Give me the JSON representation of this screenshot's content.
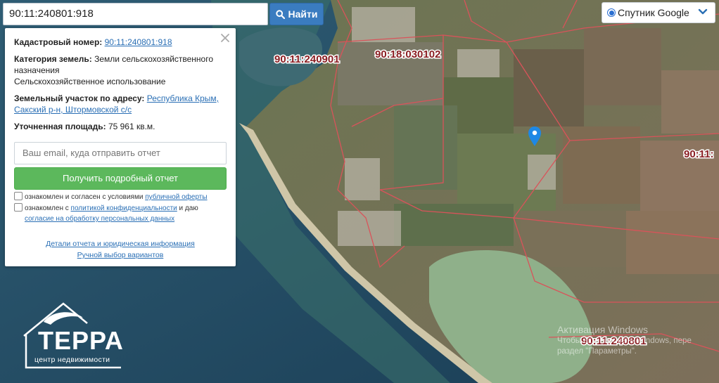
{
  "search": {
    "value": "90:11:240801:918",
    "button_label": "Найти"
  },
  "layer": {
    "label": "Спутник Google"
  },
  "panel": {
    "cadastral_label": "Кадастровый номер:",
    "cadastral_value": "90:11:240801:918",
    "category_label": "Категория земель:",
    "category_value_1": "Земли сельскохозяйственного назначения",
    "category_value_2": "Сельскохозяйственное использование",
    "address_label": "Земельный участок по адресу:",
    "address_link": "Республика Крым, Сакский р-н, Штормовской с/с",
    "area_label": "Уточненная площадь:",
    "area_value": "75 961 кв.м.",
    "email_placeholder": "Ваш email, куда отправить отчет",
    "report_button": "Получить подробный отчет",
    "consent1_text": "ознакомлен и согласен с условиями",
    "consent1_link": "публичной оферты",
    "consent2_text_a": "ознакомлен с",
    "consent2_link_a": "политикой конфиденциальности",
    "consent2_text_b": "и даю",
    "consent2_link_b": "согласие на обработку персональных данных",
    "details_link": "Детали отчета и юридическая информация",
    "manual_link": "Ручной выбор вариантов"
  },
  "map_labels": {
    "label_a": "90:11:240901",
    "label_b": "90:18:030102",
    "label_c": "90:11:",
    "label_d": "90:11:240801"
  },
  "logo": {
    "title": "ТЕРРА",
    "subtitle": "центр недвижимости"
  },
  "watermark": {
    "line1": "Активация Windows",
    "line2": "Чтобы активировать Windows, пере",
    "line3": "раздел \"Параметры\"."
  },
  "colors": {
    "parcel_border": "#d9535a",
    "label_text": "#8a1f23",
    "sea": "#21475e",
    "lagoon": "#8fb08a",
    "marker": "#1e88e5"
  }
}
